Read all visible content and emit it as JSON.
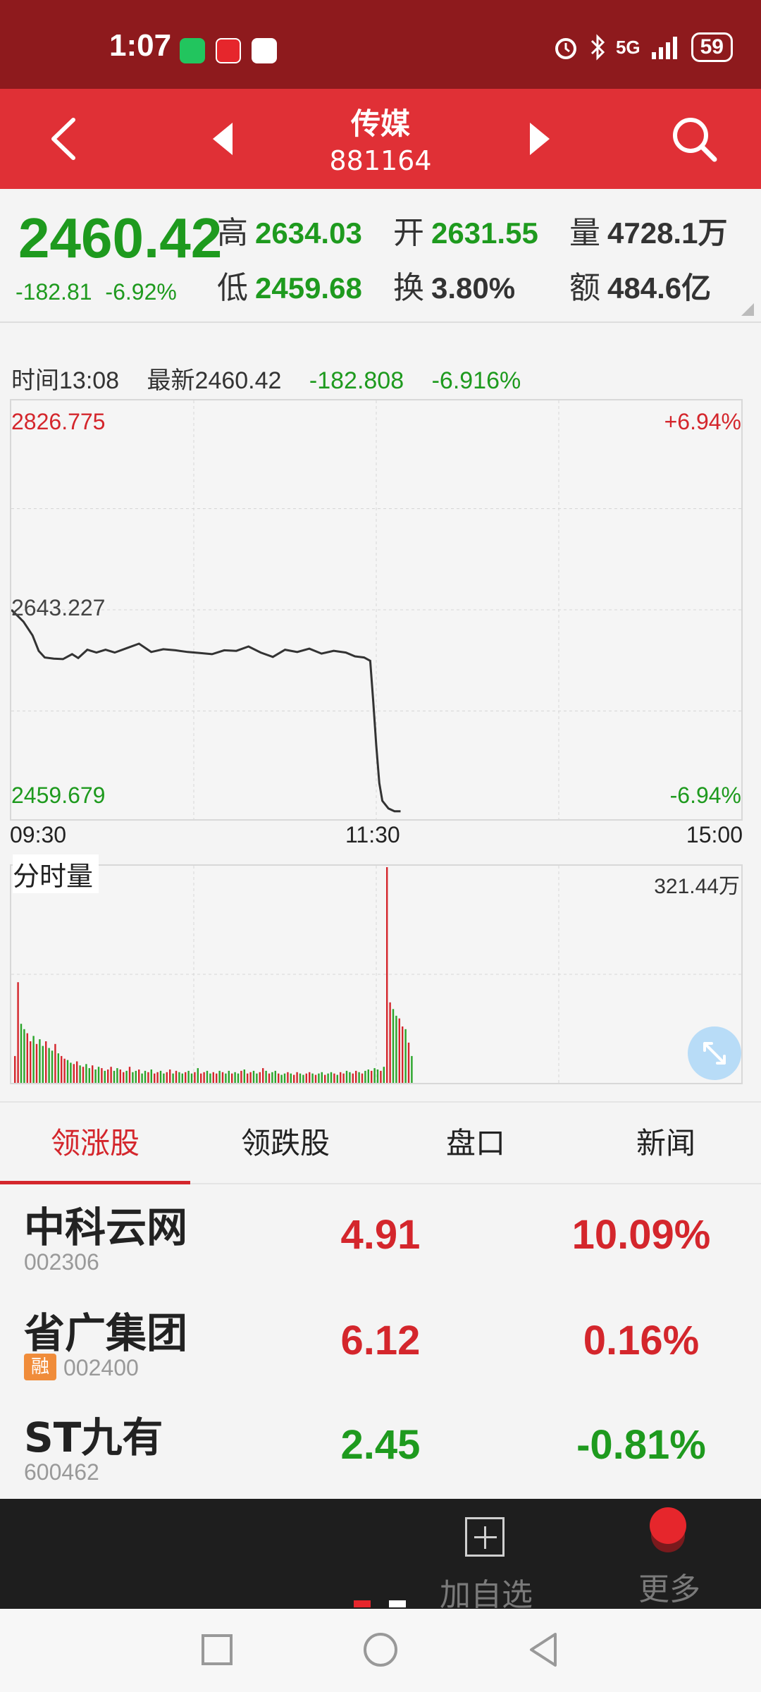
{
  "status_bar": {
    "time": "1:07",
    "network": "5G",
    "battery": "59"
  },
  "header": {
    "title": "传媒",
    "code": "881164"
  },
  "quote": {
    "price": "2460.42",
    "change": "-182.81",
    "change_pct": "-6.92%",
    "high_label": "高",
    "high": "2634.03",
    "open_label": "开",
    "open": "2631.55",
    "volume_label": "量",
    "volume": "4728.1万",
    "low_label": "低",
    "low": "2459.68",
    "turnover_label": "换",
    "turnover": "3.80%",
    "amount_label": "额",
    "amount": "484.6亿"
  },
  "info_line": {
    "time": "时间13:08",
    "latest": "最新2460.42",
    "change": "-182.808",
    "change_pct": "-6.916%"
  },
  "chart_data": [
    {
      "type": "line",
      "title": "",
      "xlabel": "",
      "ylabel": "",
      "ylim": [
        2459.679,
        2826.775
      ],
      "reference_price": 2643.227,
      "y_labels": {
        "top": "2826.775",
        "mid": "2643.227",
        "bottom": "2459.679"
      },
      "pct_labels": {
        "top": "+6.94%",
        "bottom": "-6.94%"
      },
      "x_ticks": [
        "09:30",
        "11:30",
        "15:00"
      ],
      "grid": true,
      "series": [
        {
          "minutes": [
            0,
            2,
            4,
            7,
            9,
            11,
            14,
            17,
            20,
            22,
            25,
            28,
            31,
            34,
            38,
            42,
            46,
            50,
            54,
            58,
            62,
            66,
            70,
            74,
            78,
            82,
            86,
            90,
            94,
            98,
            102,
            106,
            110,
            113,
            116,
            118,
            119,
            120,
            121,
            122,
            124,
            126,
            128
          ],
          "values": [
            2643.2,
            2638.0,
            2632.5,
            2620.0,
            2606.0,
            2600.0,
            2599.0,
            2598.5,
            2603.0,
            2599.5,
            2607.0,
            2604.5,
            2607.0,
            2604.5,
            2608.5,
            2612.5,
            2605.0,
            2607.5,
            2606.5,
            2605.0,
            2604.0,
            2603.0,
            2606.5,
            2606.0,
            2610.0,
            2604.5,
            2600.5,
            2607.0,
            2605.0,
            2608.0,
            2603.5,
            2606.0,
            2604.5,
            2601.0,
            2600.0,
            2597.0,
            2560.0,
            2520.0,
            2486.0,
            2470.0,
            2463.0,
            2460.5,
            2460.42
          ]
        }
      ]
    },
    {
      "type": "bar",
      "title": "分时量",
      "max_label": "321.44万",
      "xlim": [
        0,
        330
      ],
      "ylim": [
        0,
        321.44
      ],
      "unit": "万"
    }
  ],
  "volume_series": {
    "values": [
      40,
      150,
      88,
      80,
      74,
      62,
      70,
      58,
      65,
      55,
      62,
      52,
      48,
      58,
      44,
      40,
      36,
      34,
      30,
      28,
      32,
      26,
      24,
      28,
      22,
      26,
      20,
      24,
      22,
      18,
      20,
      24,
      18,
      22,
      20,
      16,
      18,
      24,
      16,
      18,
      20,
      14,
      18,
      16,
      20,
      14,
      16,
      18,
      14,
      16,
      20,
      14,
      18,
      16,
      14,
      16,
      18,
      14,
      16,
      22,
      14,
      16,
      18,
      14,
      16,
      14,
      18,
      16,
      14,
      18,
      14,
      16,
      14,
      18,
      20,
      14,
      16,
      18,
      14,
      16,
      22,
      18,
      14,
      16,
      18,
      14,
      12,
      14,
      16,
      14,
      12,
      16,
      14,
      12,
      14,
      16,
      14,
      12,
      14,
      16,
      12,
      14,
      16,
      14,
      12,
      16,
      14,
      18,
      16,
      14,
      18,
      16,
      14,
      18,
      20,
      18,
      22,
      20,
      18,
      24,
      321.44,
      120,
      110,
      100,
      96,
      84,
      80,
      60,
      40
    ],
    "colors": "mixed"
  },
  "tabs": [
    "领涨股",
    "领跌股",
    "盘口",
    "新闻"
  ],
  "stocks": [
    {
      "name": "中科云网",
      "code": "002306",
      "price": "4.91",
      "pct": "10.09%",
      "badge": ""
    },
    {
      "name": "省广集团",
      "code": "002400",
      "price": "6.12",
      "pct": "0.16%",
      "badge": "融"
    },
    {
      "name": "ST九有",
      "code": "600462",
      "price": "2.45",
      "pct": "-0.81%",
      "badge": ""
    }
  ],
  "action_bar": {
    "add_label": "加自选",
    "more_label": "更多"
  },
  "colors": {
    "up": "#d4262c",
    "down": "#1e9a1e",
    "header_bg": "#e03036",
    "status_bg": "#8e1a1d"
  }
}
